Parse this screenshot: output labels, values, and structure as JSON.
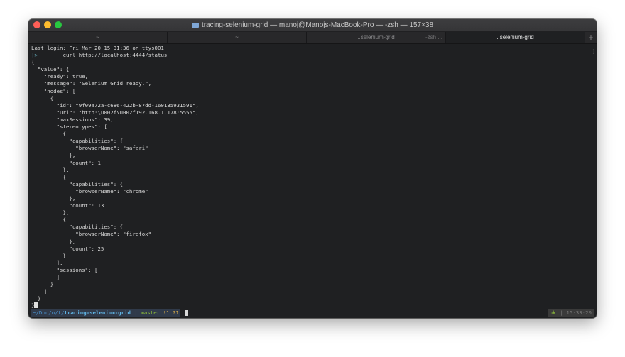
{
  "window": {
    "title": "tracing-selenium-grid — manoj@Manojs-MacBook-Pro — -zsh — 157×38"
  },
  "tabs": [
    {
      "label": "~",
      "sub": ""
    },
    {
      "label": "~",
      "sub": ""
    },
    {
      "label": "..selenium-grid",
      "sub": "-zsh ..."
    },
    {
      "label": "..selenium-grid",
      "sub": ""
    }
  ],
  "new_tab_label": "+",
  "terminal": {
    "lines": [
      "Last login: Fri Mar 20 15:31:36 on ttys001",
      "        curl http://localhost:4444/status",
      "{",
      "  \"value\": {",
      "    \"ready\": true,",
      "    \"message\": \"Selenium Grid ready.\",",
      "    \"nodes\": [",
      "      {",
      "        \"id\": \"9f09a72a-c686-422b-87dd-160135931591\",",
      "        \"uri\": \"http:\\u002f\\u002f192.168.1.178:5555\",",
      "        \"maxSessions\": 39,",
      "        \"stereotypes\": [",
      "          {",
      "            \"capabilities\": {",
      "              \"browserName\": \"safari\"",
      "            },",
      "            \"count\": 1",
      "          },",
      "          {",
      "            \"capabilities\": {",
      "              \"browserName\": \"chrome\"",
      "            },",
      "            \"count\": 13",
      "          },",
      "          {",
      "            \"capabilities\": {",
      "              \"browserName\": \"firefox\"",
      "            },",
      "            \"count\": 25",
      "          }",
      "        ],",
      "        \"sessions\": [",
      "        ]",
      "      }",
      "    ]",
      "  }",
      "}"
    ],
    "prompt_mark": "|>"
  },
  "status": {
    "path_prefix": "~/Doc/o/t/",
    "path_dir": "tracing-selenium-grid",
    "separator": "|",
    "branch": "master",
    "flags": "!1 ?1",
    "ok": "ok",
    "time": "15:33:20"
  }
}
